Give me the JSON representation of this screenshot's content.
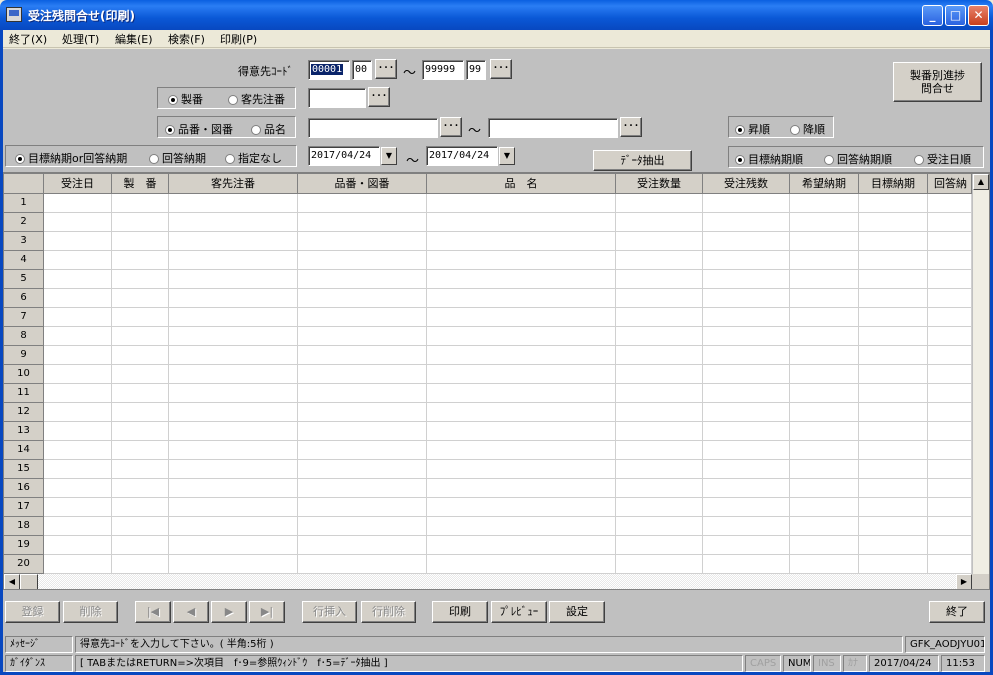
{
  "window": {
    "title": "受注残問合せ(印刷)"
  },
  "menu": [
    "終了(X)",
    "処理(T)",
    "編集(E)",
    "検索(F)",
    "印刷(P)"
  ],
  "form": {
    "customer_code_label": "得意先ｺｰﾄﾞ",
    "customer_from_1": "00001",
    "customer_from_2": "00",
    "customer_to_1": "99999",
    "customer_to_2": "99",
    "tilde": "～",
    "ellipsis": "･･･",
    "radio_seiban": "製番",
    "radio_kyakusaki": "客先注番",
    "radio_hinban": "品番・図番",
    "radio_hinmei": "品名",
    "radio_mokuhyo": "目標納期or回答納期",
    "radio_kaito": "回答納期",
    "radio_shitei": "指定なし",
    "date_from": "2017/04/24",
    "date_to": "2017/04/24",
    "extract_button": "ﾃﾞｰﾀ抽出",
    "progress_button_line1": "製番別進捗",
    "progress_button_line2": "問合せ",
    "sort_asc": "昇順",
    "sort_desc": "降順",
    "order_mokuhyo": "目標納期順",
    "order_kaito": "回答納期順",
    "order_juchu": "受注日順"
  },
  "grid": {
    "columns": [
      "受注日",
      "製　番",
      "客先注番",
      "品番・図番",
      "品　名",
      "受注数量",
      "受注残数",
      "希望納期",
      "目標納期",
      "回答納"
    ],
    "rows": [
      "1",
      "2",
      "3",
      "4",
      "5",
      "6",
      "7",
      "8",
      "9",
      "10",
      "11",
      "12",
      "13",
      "14",
      "15",
      "16",
      "17",
      "18",
      "19",
      "20"
    ]
  },
  "toolbar": {
    "register": "登録",
    "delete": "削除",
    "first": "|◀",
    "prev": "◀",
    "next": "▶",
    "last": "▶|",
    "insert_row": "行挿入",
    "delete_row": "行削除",
    "print": "印刷",
    "preview": "ﾌﾟﾚﾋﾞｭｰ",
    "settings": "設定",
    "exit": "終了"
  },
  "status": {
    "message_label": "ﾒｯｾｰｼﾞ",
    "message_text": "得意先ｺｰﾄﾞを入力して下さい。( 半角:5桁 )",
    "program_id": "GFK_AODJYU01",
    "guidance_label": "ｶﾞｲﾀﾞﾝｽ",
    "guidance_text": "[ TABまたはRETURN=>次項目　f･9=参照ｳｨﾝﾄﾞｳ　f･5=ﾃﾞｰﾀ抽出 ]",
    "caps": "CAPS",
    "num": "NUM",
    "ins": "INS",
    "kana": "ｶﾅ",
    "date": "2017/04/24",
    "time": "11:53"
  }
}
